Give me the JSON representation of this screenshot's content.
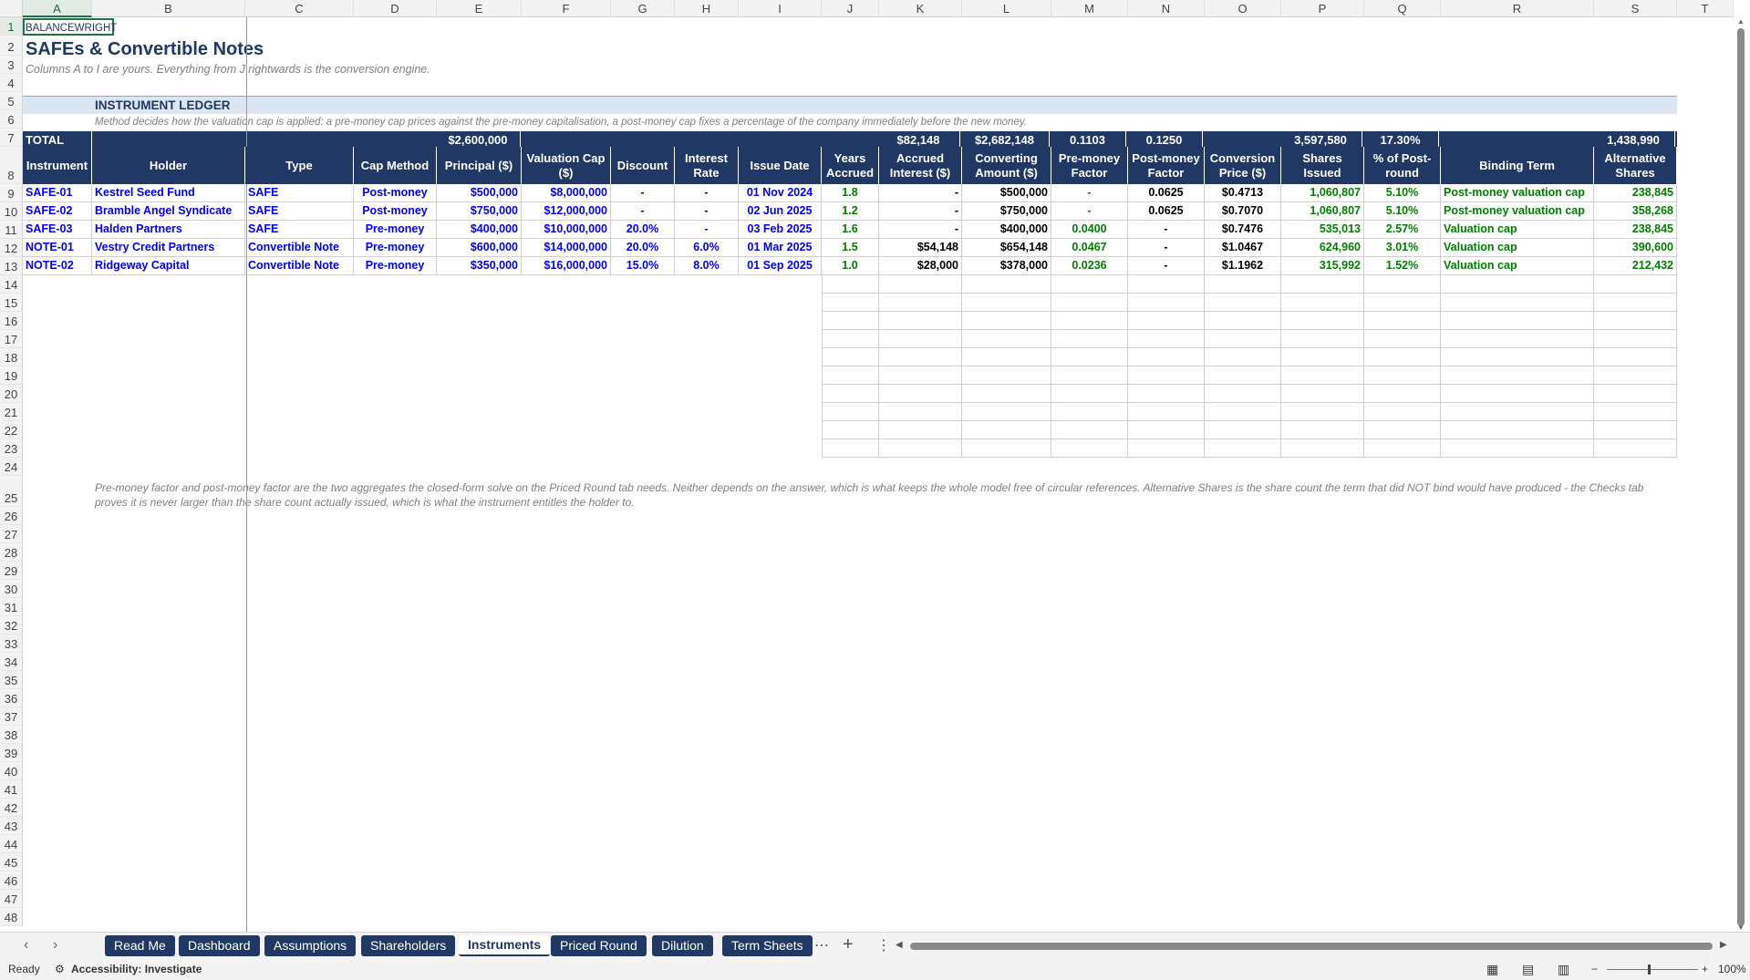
{
  "columns": [
    "A",
    "B",
    "C",
    "D",
    "E",
    "F",
    "G",
    "H",
    "I",
    "J",
    "K",
    "L",
    "M",
    "N",
    "O",
    "P",
    "Q",
    "R",
    "S",
    "T"
  ],
  "rows": [
    "1",
    "2",
    "3",
    "4",
    "5",
    "6",
    "7",
    "8",
    "9",
    "10",
    "11",
    "12",
    "13",
    "14",
    "15",
    "16",
    "17",
    "18",
    "19",
    "20",
    "21",
    "22",
    "23",
    "24",
    "25",
    "26",
    "27",
    "28",
    "29",
    "30",
    "31",
    "32",
    "33",
    "34",
    "35",
    "36",
    "37",
    "38",
    "39",
    "40",
    "41",
    "42",
    "43",
    "44",
    "45",
    "46",
    "47",
    "48"
  ],
  "brand": "BALANCEWRIGHT",
  "title": "SAFEs & Convertible Notes",
  "subtitle": "Columns A to I are yours. Everything from J rightwards is the conversion engine.",
  "section_title": "INSTRUMENT LEDGER",
  "section_note": "Method decides how the valuation cap is applied: a pre-money cap prices against the pre-money capitalisation, a post-money cap fixes a percentage of the company immediately before the new money.",
  "totals": {
    "label": "TOTAL",
    "principal": "$2,600,000",
    "accrued_interest": "$82,148",
    "converting_amount": "$2,682,148",
    "pre_money_factor": "0.1103",
    "post_money_factor": "0.1250",
    "shares_issued": "3,597,580",
    "pct_post_round": "17.30%",
    "alternative_shares": "1,438,990"
  },
  "headers": [
    "Instrument",
    "Holder",
    "Type",
    "Cap Method",
    "Principal ($)",
    "Valuation Cap ($)",
    "Discount",
    "Interest Rate",
    "Issue Date",
    "Years Accrued",
    "Accrued Interest ($)",
    "Converting Amount ($)",
    "Pre-money Factor",
    "Post-money Factor",
    "Conversion Price ($)",
    "Shares Issued",
    "% of Post-round",
    "Binding Term",
    "Alternative Shares"
  ],
  "instruments": [
    {
      "id": "SAFE-01",
      "holder": "Kestrel Seed Fund",
      "type": "SAFE",
      "cap_method": "Post-money",
      "principal": "$500,000",
      "valuation_cap": "$8,000,000",
      "discount": "-",
      "interest_rate": "-",
      "issue_date": "01 Nov 2024",
      "years_accrued": "1.8",
      "accrued_interest": "-",
      "converting_amount": "$500,000",
      "pre_money_factor": "-",
      "post_money_factor": "0.0625",
      "conversion_price": "$0.4713",
      "shares_issued": "1,060,807",
      "pct_post_round": "5.10%",
      "binding_term": "Post-money valuation cap",
      "alternative_shares": "238,845"
    },
    {
      "id": "SAFE-02",
      "holder": "Bramble Angel Syndicate",
      "type": "SAFE",
      "cap_method": "Post-money",
      "principal": "$750,000",
      "valuation_cap": "$12,000,000",
      "discount": "-",
      "interest_rate": "-",
      "issue_date": "02 Jun 2025",
      "years_accrued": "1.2",
      "accrued_interest": "-",
      "converting_amount": "$750,000",
      "pre_money_factor": "-",
      "post_money_factor": "0.0625",
      "conversion_price": "$0.7070",
      "shares_issued": "1,060,807",
      "pct_post_round": "5.10%",
      "binding_term": "Post-money valuation cap",
      "alternative_shares": "358,268"
    },
    {
      "id": "SAFE-03",
      "holder": "Halden Partners",
      "type": "SAFE",
      "cap_method": "Pre-money",
      "principal": "$400,000",
      "valuation_cap": "$10,000,000",
      "discount": "20.0%",
      "interest_rate": "-",
      "issue_date": "03 Feb 2025",
      "years_accrued": "1.6",
      "accrued_interest": "-",
      "converting_amount": "$400,000",
      "pre_money_factor": "0.0400",
      "post_money_factor": "-",
      "conversion_price": "$0.7476",
      "shares_issued": "535,013",
      "pct_post_round": "2.57%",
      "binding_term": "Valuation cap",
      "alternative_shares": "238,845"
    },
    {
      "id": "NOTE-01",
      "holder": "Vestry Credit Partners",
      "type": "Convertible Note",
      "cap_method": "Pre-money",
      "principal": "$600,000",
      "valuation_cap": "$14,000,000",
      "discount": "20.0%",
      "interest_rate": "6.0%",
      "issue_date": "01 Mar 2025",
      "years_accrued": "1.5",
      "accrued_interest": "$54,148",
      "converting_amount": "$654,148",
      "pre_money_factor": "0.0467",
      "post_money_factor": "-",
      "conversion_price": "$1.0467",
      "shares_issued": "624,960",
      "pct_post_round": "3.01%",
      "binding_term": "Valuation cap",
      "alternative_shares": "390,600"
    },
    {
      "id": "NOTE-02",
      "holder": "Ridgeway Capital",
      "type": "Convertible Note",
      "cap_method": "Pre-money",
      "principal": "$350,000",
      "valuation_cap": "$16,000,000",
      "discount": "15.0%",
      "interest_rate": "8.0%",
      "issue_date": "01 Sep 2025",
      "years_accrued": "1.0",
      "accrued_interest": "$28,000",
      "converting_amount": "$378,000",
      "pre_money_factor": "0.0236",
      "post_money_factor": "-",
      "conversion_price": "$1.1962",
      "shares_issued": "315,992",
      "pct_post_round": "1.52%",
      "binding_term": "Valuation cap",
      "alternative_shares": "212,432"
    }
  ],
  "footnote": "Pre-money factor and post-money factor are the two aggregates the closed-form solve on the Priced Round tab needs. Neither depends on the answer, which is what keeps the whole model free of circular references. Alternative Shares is the share count the term that did NOT bind would have produced - the Checks tab proves it is never larger than the share count actually issued, which is what the instrument entitles the holder to.",
  "tabs": [
    "Read Me",
    "Dashboard",
    "Assumptions",
    "Shareholders",
    "Instruments",
    "Priced Round",
    "Dilution",
    "Term Sheets"
  ],
  "active_tab": "Instruments",
  "status": {
    "ready": "Ready",
    "accessibility": "Accessibility: Investigate",
    "zoom": "100%"
  },
  "colors": {
    "navy": "#1f3864",
    "section_band": "#dce6f1",
    "input_blue": "#0000ff",
    "calc_green": "#008000"
  }
}
